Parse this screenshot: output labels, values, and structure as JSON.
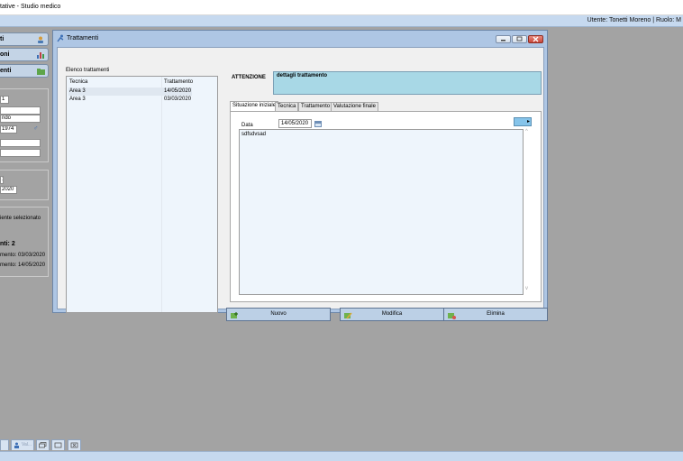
{
  "app": {
    "title": "tative - Studio medico"
  },
  "userbar": {
    "user": "Utente: Tonetti Moreno | Ruolo: M"
  },
  "left_panel": {
    "nav": [
      {
        "label": "ti",
        "icon": "person-icon"
      },
      {
        "label": "oni",
        "icon": "chart-icon"
      },
      {
        "label": "enti",
        "icon": "folder-icon"
      }
    ],
    "patient": {
      "field1": "1",
      "field3": "ndo",
      "birth": "1974"
    },
    "stats": {
      "field1": "1",
      "date": "2020"
    },
    "summary": {
      "line1": "iente selezionato",
      "line2": "nti: 2",
      "line3": "mento: 03/03/2020",
      "line4": "mento: 14/05/2020"
    }
  },
  "dialog": {
    "title": "Trattamenti",
    "list": {
      "caption": "Elenco trattamenti",
      "headers": [
        "Tecnica",
        "Trattamento"
      ],
      "rows": [
        {
          "tecnica": "Area 3",
          "trattamento": "14/05/2020"
        },
        {
          "tecnica": "Area 3",
          "trattamento": "03/03/2020"
        }
      ]
    },
    "attention": {
      "label": "ATTENZIONE",
      "text": "dettagli trattamento"
    },
    "tabs": [
      "Situazione iniziale",
      "Tecnica",
      "Trattamento",
      "Valutazione finale"
    ],
    "active_tab": 0,
    "panel": {
      "date_label": "Data",
      "date_value": "14/05/2020",
      "notes": "sdfsdvsad"
    },
    "buttons": {
      "new": "Nuovo",
      "edit": "Modifica",
      "delete": "Elimina"
    }
  },
  "taskbar": {
    "item2_label": "Val..."
  },
  "colors": {
    "accent": "#aec6e4",
    "attention_bg": "#a8d8e6",
    "list_bg": "#eef5fc",
    "close_red": "#d9534f"
  }
}
